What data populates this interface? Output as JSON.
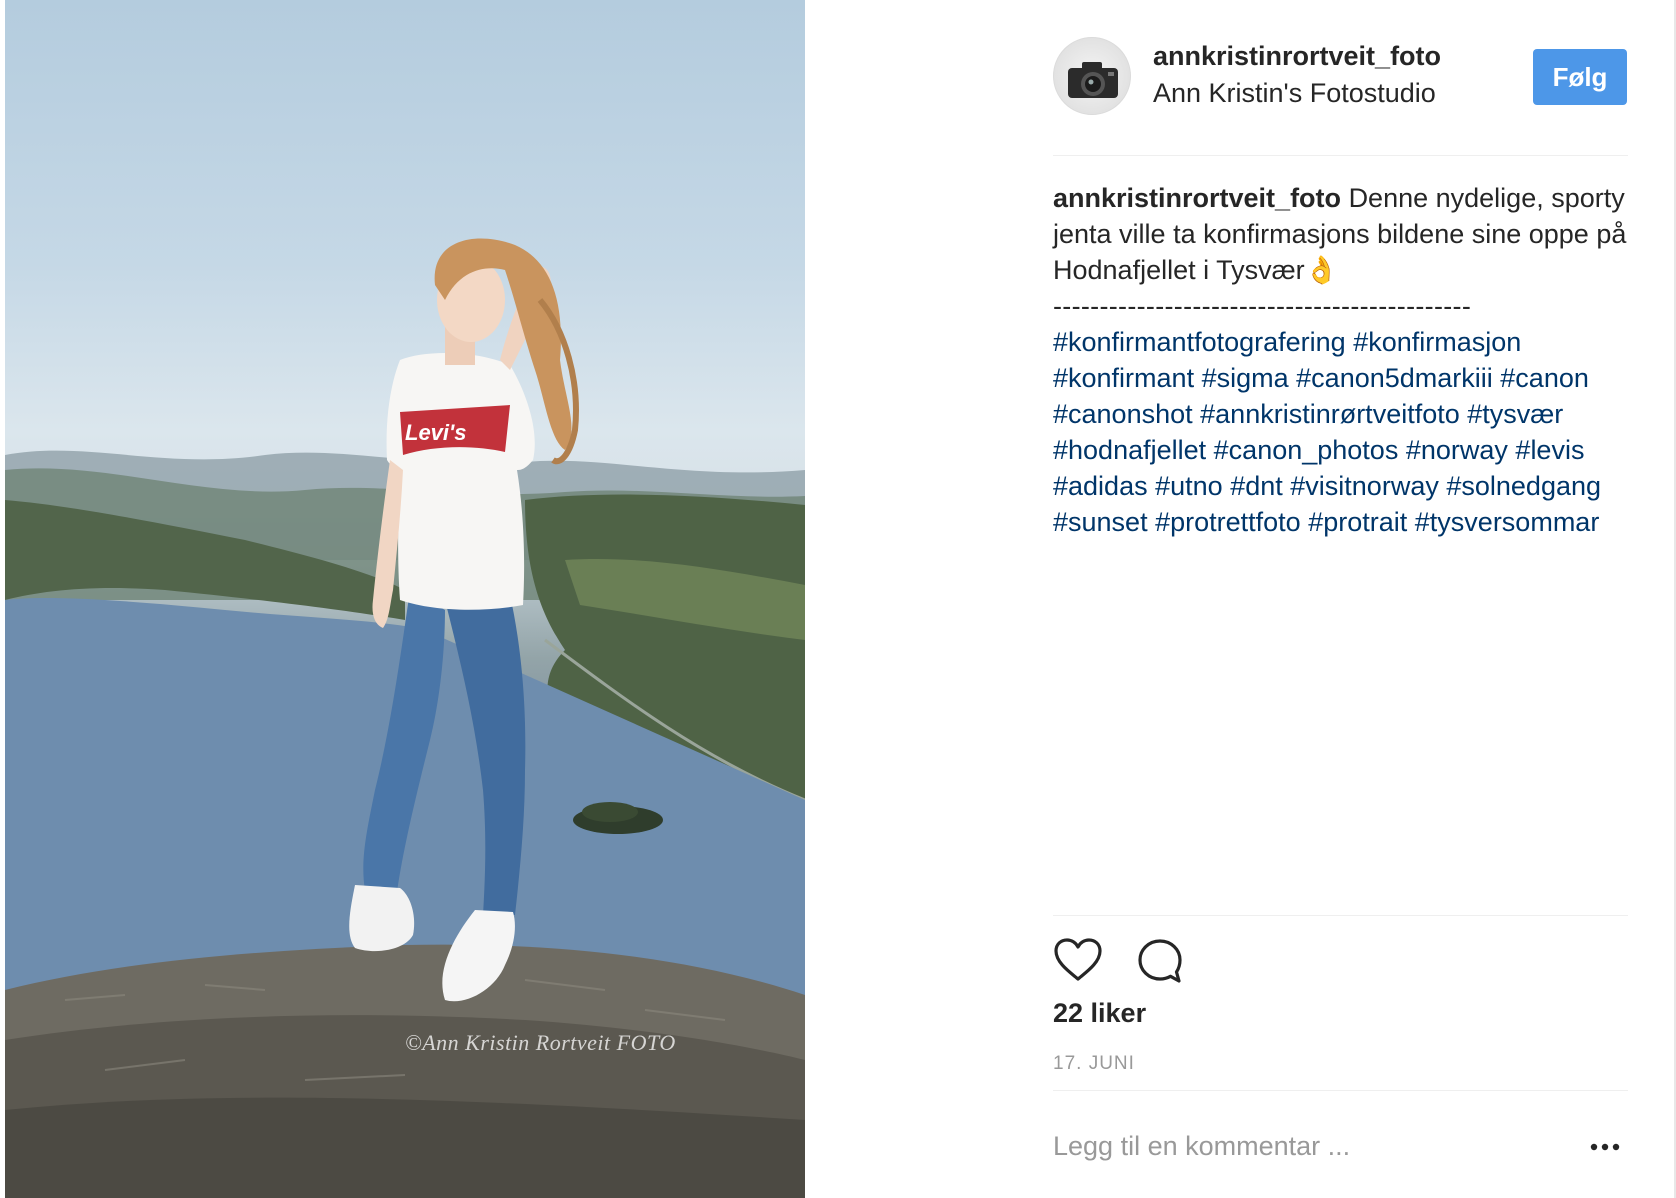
{
  "post": {
    "photo_alt": "Girl in Levi's t-shirt and jeans standing on a rock above a fjord",
    "watermark": "©Ann Kristin Rortveit FOTO",
    "shirt_logo": "Levi's"
  },
  "header": {
    "username": "annkristinrortveit_foto",
    "location": "Ann Kristin's Fotostudio",
    "follow_label": "Følg",
    "avatar_icon": "camera-icon"
  },
  "caption": {
    "username": "annkristinrortveit_foto",
    "text": "Denne nydelige, sporty jenta ville ta konfirmasjons bildene sine oppe på Hodnafjellet i Tysvær👌",
    "separator": "---------------------------------------------",
    "hashtags": [
      "#konfirmantfotografering",
      "#konfirmasjon",
      "#konfirmant",
      "#sigma",
      "#canon5dmarkiii",
      "#canon",
      "#canonshot",
      "#annkristinrørtveitfoto",
      "#tysvær",
      "#hodnafjellet",
      "#canon_photos",
      "#norway",
      "#levis",
      "#adidas",
      "#utno",
      "#dnt",
      "#visitnorway",
      "#solnedgang",
      "#sunset",
      "#protrettfoto",
      "#protrait",
      "#tysversommar"
    ]
  },
  "actions": {
    "like_icon": "heart-icon",
    "comment_icon": "comment-icon",
    "likes": "22 liker",
    "date": "17. JUNI"
  },
  "comment": {
    "placeholder": "Legg til en kommentar ...",
    "more_icon": "more-options-icon"
  },
  "colors": {
    "follow_button": "#4d97e8",
    "hashtag": "#003569",
    "text": "#262626",
    "muted": "#999999"
  }
}
